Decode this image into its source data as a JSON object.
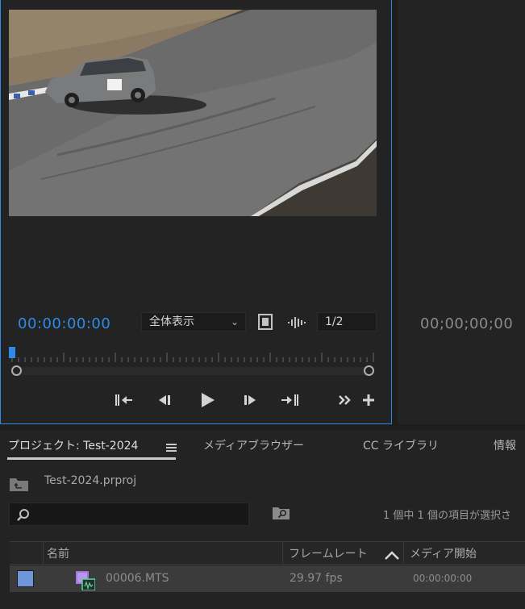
{
  "source_monitor": {
    "timecode": "00:00:00:00",
    "zoom_select": "全体表示",
    "resolution_select": "1/2",
    "playhead_position": 0.0
  },
  "program_monitor": {
    "timecode": "00;00;00;00"
  },
  "project_panel": {
    "tabs": [
      "プロジェクト: Test-2024",
      "メディアブラウザー",
      "CC ライブラリ",
      "情報"
    ],
    "project_file": "Test-2024.prproj",
    "search_placeholder": "",
    "selection_status": "1 個中 1 個の項目が選択さ",
    "columns": {
      "name": "名前",
      "frame_rate": "フレームレート",
      "media_start": "メディア開始"
    },
    "items": [
      {
        "name": "00006.MTS",
        "frame_rate": "29.97 fps",
        "media_start": "00:00:00:00",
        "label_color": "#6f96d6"
      }
    ]
  },
  "icons": {
    "menu": "hamburger-menu-icon",
    "folder_up": "folder-up-icon",
    "search": "search-icon",
    "new_bin_search": "bin-search-icon",
    "sort": "chevron-up-icon"
  },
  "colors": {
    "accent": "#2d8ceb",
    "panel": "#232323",
    "row_selected": "#3b3b3b"
  }
}
